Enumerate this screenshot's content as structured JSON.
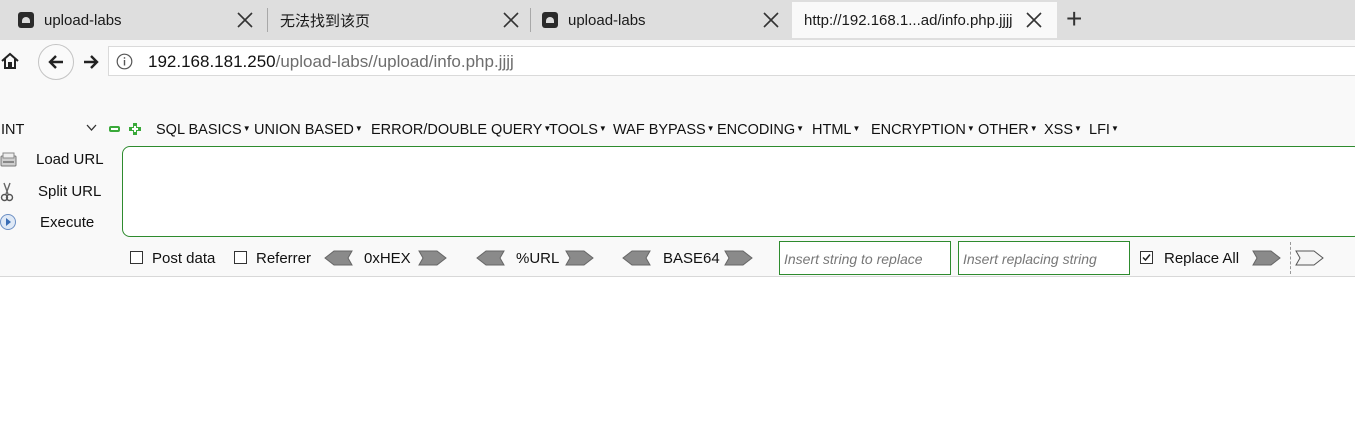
{
  "tabs": [
    {
      "label": "upload-labs"
    },
    {
      "label": "无法找到该页"
    },
    {
      "label": "upload-labs"
    },
    {
      "label": "http://192.168.1...ad/info.php.jjjj"
    }
  ],
  "new_tab_symbol": "+",
  "address": {
    "host": "192.168.181.250",
    "path": "/upload-labs//upload/info.php.jjjj"
  },
  "hackbar": {
    "type_select": "INT",
    "menus": [
      "SQL BASICS",
      "UNION BASED",
      "ERROR/DOUBLE QUERY",
      "TOOLS",
      "WAF BYPASS",
      "ENCODING",
      "HTML",
      "ENCRYPTION",
      "OTHER",
      "XSS",
      "LFI"
    ],
    "load_url": "Load URL",
    "split_url": "Split URL",
    "execute": "Execute",
    "url_value": "",
    "post_data": "Post data",
    "referrer": "Referrer",
    "hex": "0xHEX",
    "url_enc": "%URL",
    "base64": "BASE64",
    "replace_placeholder": "Insert string to replace",
    "replacing_placeholder": "Insert replacing string",
    "replace_all": "Replace All",
    "replace_all_checked": true
  },
  "colors": {
    "accent_green": "#2e8b2e",
    "tabstrip": "#dedede",
    "toolbar": "#f9f9f9"
  }
}
